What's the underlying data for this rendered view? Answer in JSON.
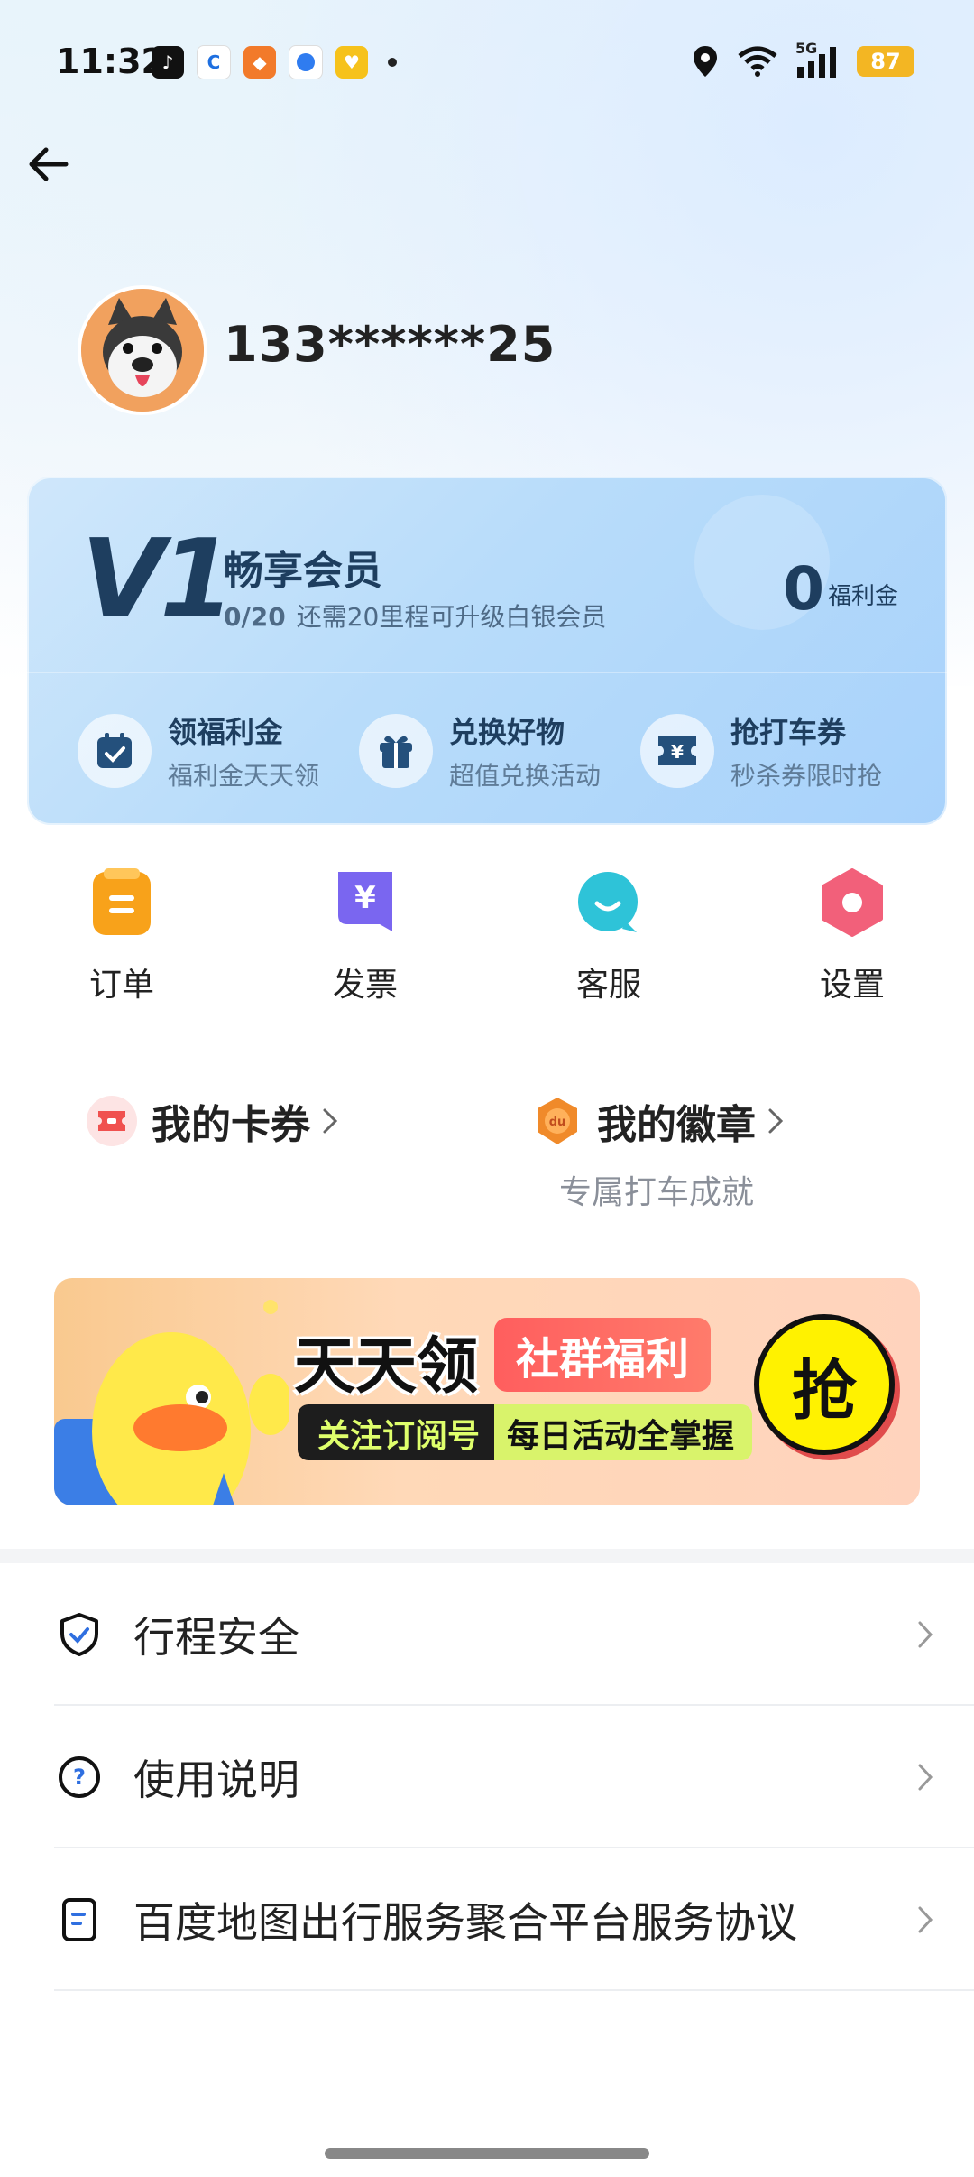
{
  "status_bar": {
    "time": "11:32",
    "network": "5G",
    "battery": "87",
    "notification_icons": [
      "tiktok-icon",
      "c-app-icon",
      "fox-app-icon",
      "blue-app-icon",
      "yellow-app-icon"
    ]
  },
  "profile": {
    "username": "133******25"
  },
  "member_card": {
    "level": "V1",
    "title": "畅享会员",
    "progress_value": "0/20",
    "progress_text": "还需20里程可升级白银会员",
    "coin_amount": "0",
    "coin_label": "福利金",
    "actions": [
      {
        "title": "领福利金",
        "sub": "福利金天天领"
      },
      {
        "title": "兑换好物",
        "sub": "超值兑换活动"
      },
      {
        "title": "抢打车券",
        "sub": "秒杀券限时抢"
      }
    ]
  },
  "quick_menu": [
    {
      "label": "订单"
    },
    {
      "label": "发票"
    },
    {
      "label": "客服"
    },
    {
      "label": "设置"
    }
  ],
  "entries": {
    "coupons_title": "我的卡券",
    "badges_title": "我的徽章",
    "badges_sub": "专属打车成就"
  },
  "banner": {
    "title": "天天领",
    "tag": "社群福利",
    "strip_left": "关注订阅号",
    "strip_right": "每日活动全掌握",
    "grab": "抢"
  },
  "settings_list": [
    {
      "label": "行程安全"
    },
    {
      "label": "使用说明"
    },
    {
      "label": "百度地图出行服务聚合平台服务协议"
    }
  ],
  "colors": {
    "accent_blue": "#1e3e5f",
    "order_orange": "#f8a21a",
    "invoice_purple": "#7a66f0",
    "service_teal": "#2ec3d8",
    "settings_pink": "#f2607a",
    "battery_yellow": "#f3b623"
  }
}
